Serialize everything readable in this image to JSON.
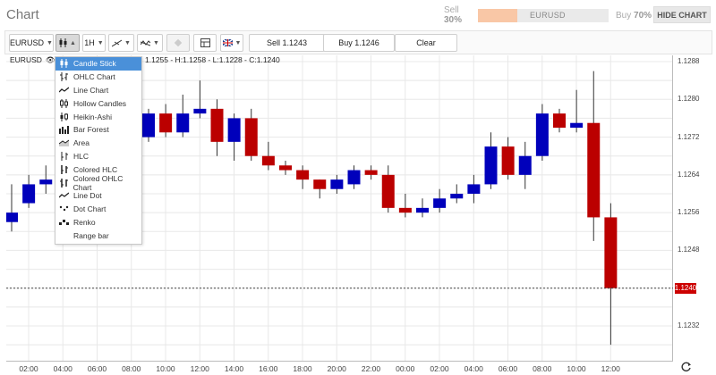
{
  "header": {
    "title": "Chart",
    "sentiment": {
      "sell_label": "Sell",
      "sell_pct": "30%",
      "buy_label": "Buy",
      "buy_pct": "70%",
      "symbol": "EURUSD",
      "sell_fraction": 0.3
    },
    "hide_chart_label": "HIDE CHART"
  },
  "toolbar": {
    "symbol": "EURUSD",
    "timeframe": "1H",
    "sell_button": "Sell 1.1243",
    "buy_button": "Buy 1.1246",
    "clear_button": "Clear"
  },
  "info": {
    "symbol": "EURUSD",
    "type_abbrev": "Ca",
    "ohlc": "1.1255 - H:1.1258 - L:1.1228 - C:1.1240"
  },
  "chart_type_menu": {
    "items": [
      {
        "label": "Candle Stick",
        "icon": "candle-stick-icon",
        "selected": true
      },
      {
        "label": "OHLC Chart",
        "icon": "ohlc-icon",
        "selected": false
      },
      {
        "label": "Line Chart",
        "icon": "line-chart-icon",
        "selected": false
      },
      {
        "label": "Hollow Candles",
        "icon": "hollow-candles-icon",
        "selected": false
      },
      {
        "label": "Heikin-Ashi",
        "icon": "heikin-ashi-icon",
        "selected": false
      },
      {
        "label": "Bar Forest",
        "icon": "bar-forest-icon",
        "selected": false
      },
      {
        "label": "Area",
        "icon": "area-icon",
        "selected": false
      },
      {
        "label": "HLC",
        "icon": "hlc-icon",
        "selected": false
      },
      {
        "label": "Colored HLC",
        "icon": "colored-hlc-icon",
        "selected": false
      },
      {
        "label": "Colored OHLC Chart",
        "icon": "colored-ohlc-icon",
        "selected": false
      },
      {
        "label": "Line Dot",
        "icon": "line-dot-icon",
        "selected": false
      },
      {
        "label": "Dot Chart",
        "icon": "dot-chart-icon",
        "selected": false
      },
      {
        "label": "Renko",
        "icon": "renko-icon",
        "selected": false
      },
      {
        "label": "Range bar",
        "icon": "",
        "selected": false
      }
    ]
  },
  "colors": {
    "up": "#0000bb",
    "down": "#bb0000",
    "menu_selected": "#4a90d9",
    "price_tag": "#cc0000"
  },
  "chart_data": {
    "type": "candlestick",
    "symbol": "EURUSD",
    "interval": "1H",
    "current_price": "1.1240",
    "ylim": [
      1.1225,
      1.1292
    ],
    "y_ticks": [
      "1.1288",
      "1.1280",
      "1.1272",
      "1.1264",
      "1.1256",
      "1.1248",
      "1.1232"
    ],
    "x_ticks": [
      "02:00",
      "04:00",
      "06:00",
      "08:00",
      "10:00",
      "12:00",
      "14:00",
      "16:00",
      "18:00",
      "20:00",
      "22:00",
      "00:00",
      "02:00",
      "04:00",
      "06:00",
      "08:00",
      "10:00",
      "12:00"
    ],
    "candles": [
      {
        "o": 1.1254,
        "h": 1.1262,
        "l": 1.1252,
        "c": 1.1256
      },
      {
        "o": 1.1258,
        "h": 1.1264,
        "l": 1.1257,
        "c": 1.1262
      },
      {
        "o": 1.1262,
        "h": 1.1266,
        "l": 1.126,
        "c": 1.1263
      },
      {
        "o": 1.1263,
        "h": 1.1265,
        "l": 1.1258,
        "c": 1.1264
      },
      {
        "o": 1.1264,
        "h": 1.1266,
        "l": 1.1262,
        "c": 1.1265
      },
      {
        "o": 1.1266,
        "h": 1.1268,
        "l": 1.1264,
        "c": 1.1267
      },
      {
        "o": 1.1267,
        "h": 1.1279,
        "l": 1.1262,
        "c": 1.1279
      },
      {
        "o": 1.1279,
        "h": 1.1279,
        "l": 1.1265,
        "c": 1.1272
      },
      {
        "o": 1.1272,
        "h": 1.1278,
        "l": 1.1271,
        "c": 1.1277
      },
      {
        "o": 1.1277,
        "h": 1.1279,
        "l": 1.1272,
        "c": 1.1273
      },
      {
        "o": 1.1273,
        "h": 1.1281,
        "l": 1.1272,
        "c": 1.1277
      },
      {
        "o": 1.1277,
        "h": 1.1284,
        "l": 1.1276,
        "c": 1.1278
      },
      {
        "o": 1.1278,
        "h": 1.128,
        "l": 1.1268,
        "c": 1.1271
      },
      {
        "o": 1.1271,
        "h": 1.1277,
        "l": 1.1267,
        "c": 1.1276
      },
      {
        "o": 1.1276,
        "h": 1.1278,
        "l": 1.1267,
        "c": 1.1268
      },
      {
        "o": 1.1268,
        "h": 1.1271,
        "l": 1.1265,
        "c": 1.1266
      },
      {
        "o": 1.1266,
        "h": 1.1267,
        "l": 1.1264,
        "c": 1.1265
      },
      {
        "o": 1.1265,
        "h": 1.1266,
        "l": 1.1261,
        "c": 1.1263
      },
      {
        "o": 1.1263,
        "h": 1.1263,
        "l": 1.1259,
        "c": 1.1261
      },
      {
        "o": 1.1261,
        "h": 1.1264,
        "l": 1.126,
        "c": 1.1263
      },
      {
        "o": 1.1262,
        "h": 1.1266,
        "l": 1.1261,
        "c": 1.1265
      },
      {
        "o": 1.1265,
        "h": 1.1266,
        "l": 1.1263,
        "c": 1.1264
      },
      {
        "o": 1.1264,
        "h": 1.1266,
        "l": 1.1256,
        "c": 1.1257
      },
      {
        "o": 1.1257,
        "h": 1.126,
        "l": 1.1255,
        "c": 1.1256
      },
      {
        "o": 1.1256,
        "h": 1.1259,
        "l": 1.1255,
        "c": 1.1257
      },
      {
        "o": 1.1257,
        "h": 1.1261,
        "l": 1.1256,
        "c": 1.1259
      },
      {
        "o": 1.1259,
        "h": 1.1262,
        "l": 1.1258,
        "c": 1.126
      },
      {
        "o": 1.126,
        "h": 1.1264,
        "l": 1.1258,
        "c": 1.1262
      },
      {
        "o": 1.1262,
        "h": 1.1273,
        "l": 1.1261,
        "c": 1.127
      },
      {
        "o": 1.127,
        "h": 1.1272,
        "l": 1.1263,
        "c": 1.1264
      },
      {
        "o": 1.1264,
        "h": 1.1271,
        "l": 1.1261,
        "c": 1.1268
      },
      {
        "o": 1.1268,
        "h": 1.1279,
        "l": 1.1267,
        "c": 1.1277
      },
      {
        "o": 1.1277,
        "h": 1.1278,
        "l": 1.1273,
        "c": 1.1274
      },
      {
        "o": 1.1274,
        "h": 1.1282,
        "l": 1.1273,
        "c": 1.1275
      },
      {
        "o": 1.1275,
        "h": 1.1286,
        "l": 1.125,
        "c": 1.1255
      },
      {
        "o": 1.1255,
        "h": 1.1258,
        "l": 1.1228,
        "c": 1.124
      }
    ]
  }
}
